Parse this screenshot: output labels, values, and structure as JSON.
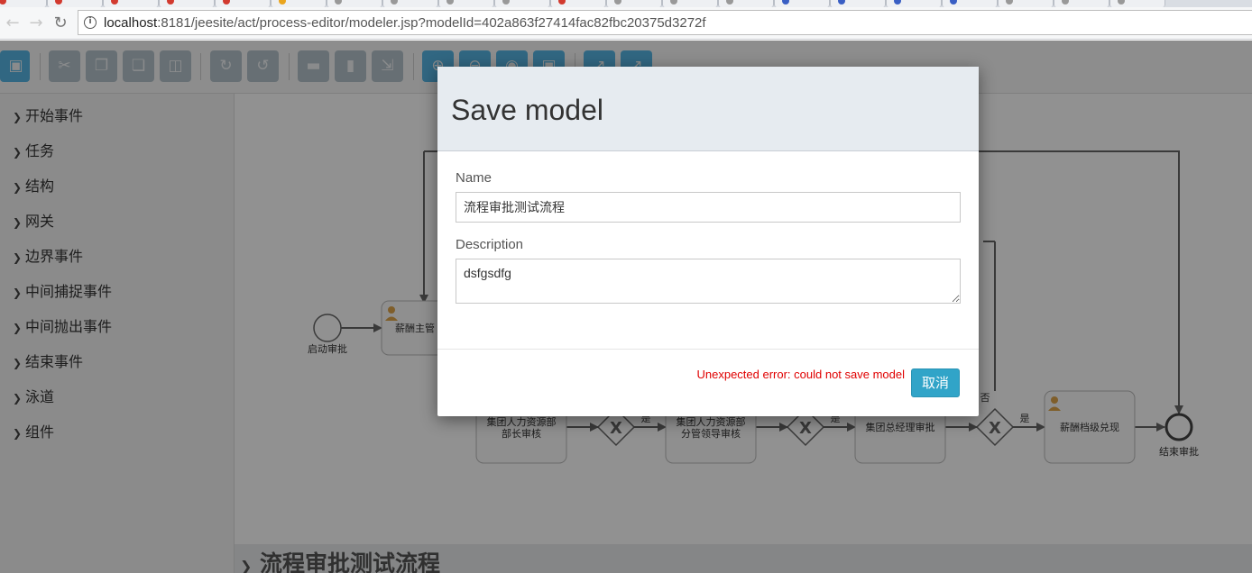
{
  "browser": {
    "url_host": "localhost",
    "url_rest": ":8181/jeesite/act/process-editor/modeler.jsp?modelId=402a863f27414fac82fbc20375d3272f",
    "tab_accents": [
      "#d23a2f",
      "#d23a2f",
      "#d23a2f",
      "#d23a2f",
      "#d23a2f",
      "#eaa51e",
      "#999999",
      "#999999",
      "#999999",
      "#999999",
      "#d23a2f",
      "#999999",
      "#999999",
      "#999999",
      "#3a5fc4",
      "#3a5fc4",
      "#3a5fc4",
      "#3a5fc4",
      "#999999",
      "#999999",
      "#999999"
    ]
  },
  "icons": {
    "back": "back-arrow-icon",
    "forward": "forward-arrow-icon",
    "reload": "reload-icon",
    "info": "info-circle-icon"
  },
  "palette": {
    "items": [
      "开始事件",
      "任务",
      "结构",
      "网关",
      "边界事件",
      "中间捕捉事件",
      "中间抛出事件",
      "结束事件",
      "泳道",
      "组件"
    ]
  },
  "diagram": {
    "start_label": "启动审批",
    "task1_label": "薪酬主管",
    "task2_line1": "集团人力资源部",
    "task2_line2": "部长审核",
    "task3_line1": "集团人力资源部",
    "task3_line2": "分管领导审核",
    "task4_label": "集团总经理审批",
    "task5_label": "薪酬档级兑现",
    "end_label": "结束审批",
    "yes_label": "是",
    "no_label": "否",
    "gateway_symbol": "X"
  },
  "bottom": {
    "model_title": "流程审批测试流程"
  },
  "modal": {
    "title": "Save model",
    "name_label": "Name",
    "name_value": "流程审批测试流程",
    "description_label": "Description",
    "description_value": "dsfgsdfg",
    "error_text": "Unexpected error: could not save model",
    "cancel_label": "取消"
  },
  "colors": {
    "accent": "#31a4c8",
    "error": "#e00000",
    "header_bg": "#e6ebf0"
  }
}
